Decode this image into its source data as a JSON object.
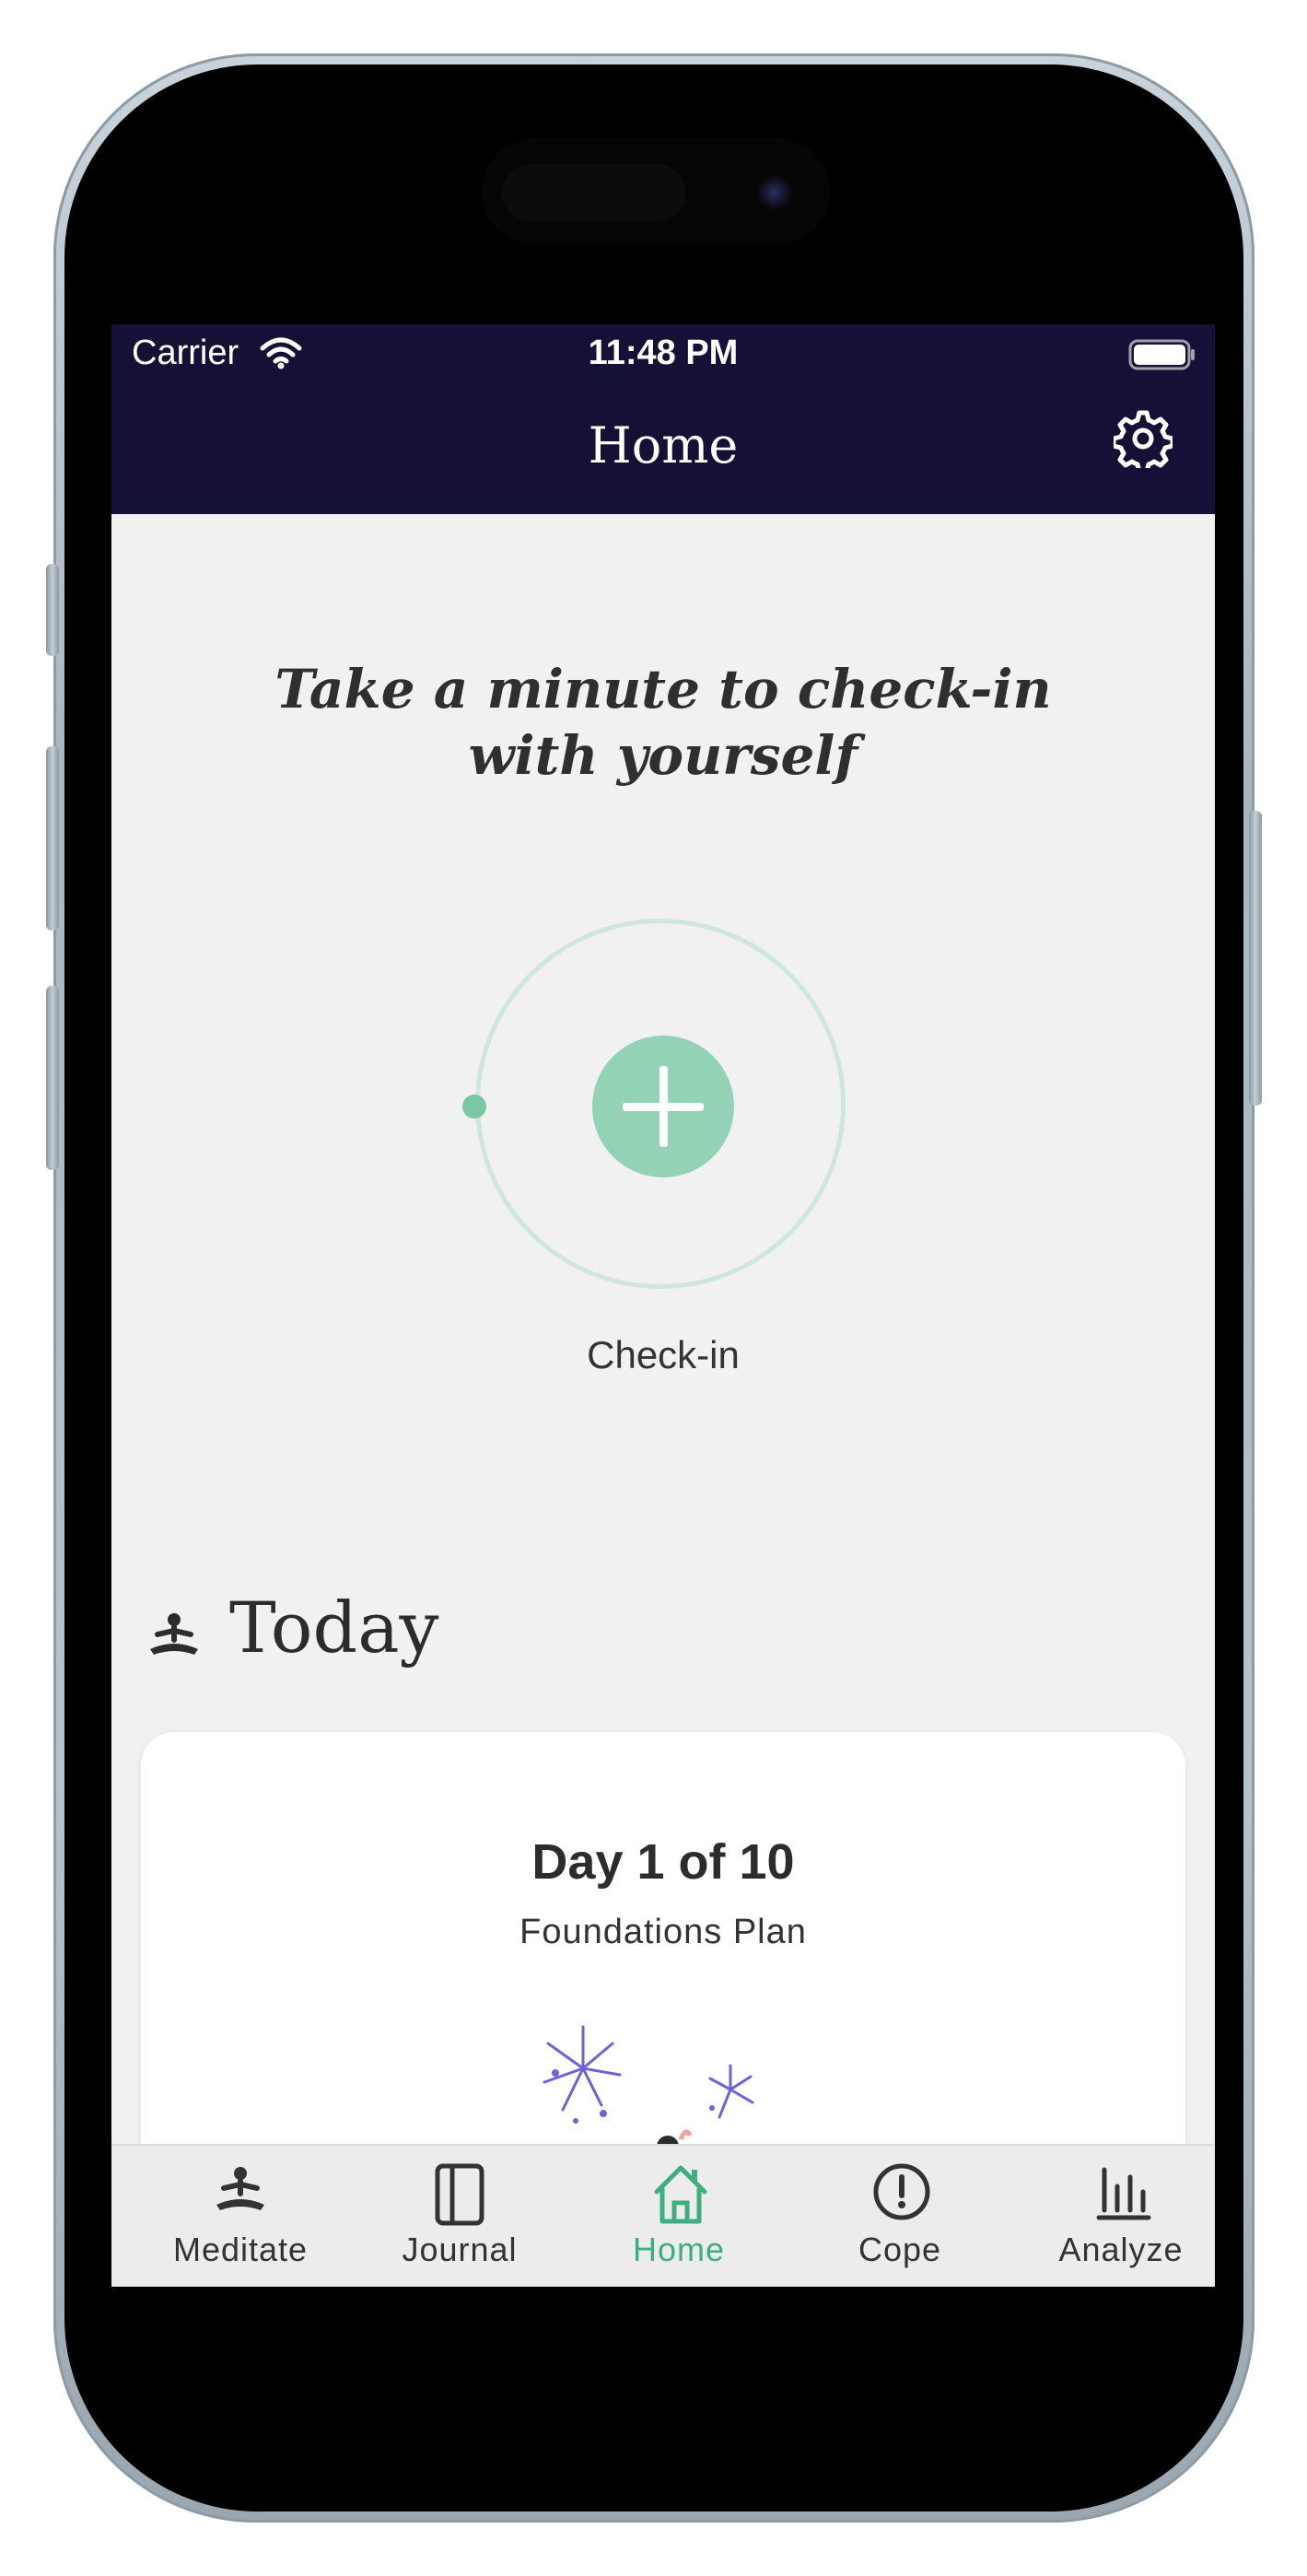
{
  "status_bar": {
    "carrier": "Carrier",
    "time": "11:48 PM"
  },
  "header": {
    "title": "Home",
    "settings_icon": "gear-icon",
    "background_color": "#151136"
  },
  "checkin": {
    "prompt_line1": "Take a minute to check-in",
    "prompt_line2": "with yourself",
    "button_icon": "plus-icon",
    "label": "Check-in",
    "accent_color": "#93d2b5"
  },
  "today": {
    "title": "Today",
    "icon": "meditation-icon",
    "card": {
      "title": "Day 1 of 10",
      "subtitle": "Foundations Plan"
    }
  },
  "tabbar": {
    "active_color": "#3fae7e",
    "tabs": [
      {
        "label": "Meditate",
        "icon": "meditation-icon",
        "active": false
      },
      {
        "label": "Journal",
        "icon": "journal-icon",
        "active": false
      },
      {
        "label": "Home",
        "icon": "home-icon",
        "active": true
      },
      {
        "label": "Cope",
        "icon": "alert-circle-icon",
        "active": false
      },
      {
        "label": "Analyze",
        "icon": "bar-chart-icon",
        "active": false
      }
    ]
  }
}
